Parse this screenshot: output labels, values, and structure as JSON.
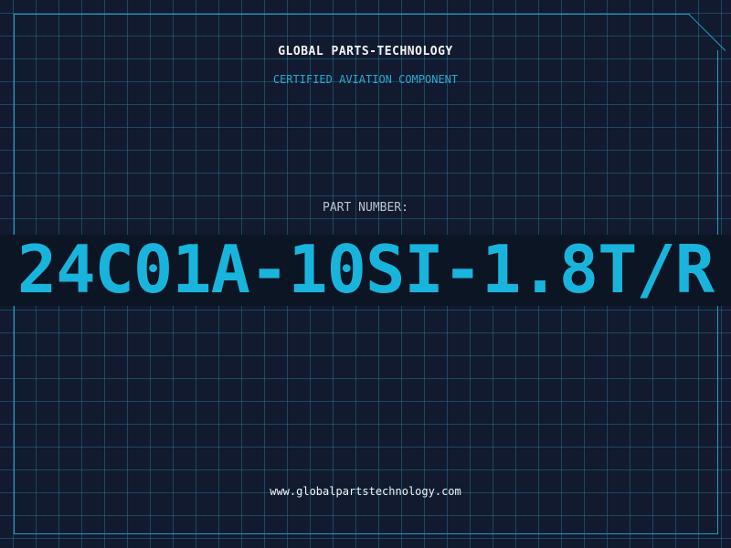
{
  "header": {
    "company_name": "GLOBAL PARTS-TECHNOLOGY",
    "tagline": "CERTIFIED AVIATION COMPONENT"
  },
  "part": {
    "label": "PART NUMBER:",
    "number": "24C01A-10SI-1.8T/R"
  },
  "footer": {
    "website": "www.globalpartstechnology.com"
  },
  "colors": {
    "background": "#111a2e",
    "accent": "#19b4dc",
    "grid": "#236e8c",
    "text": "#f2f5f8"
  }
}
